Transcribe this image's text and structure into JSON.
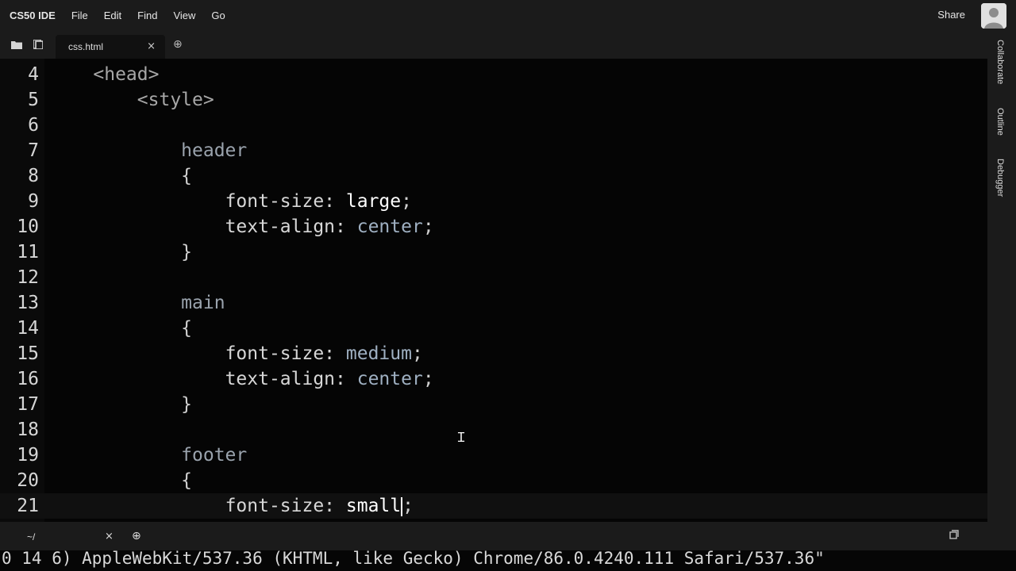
{
  "menubar": {
    "brand": "CS50 IDE",
    "items": [
      "File",
      "Edit",
      "Find",
      "View",
      "Go"
    ],
    "share_label": "Share"
  },
  "tabs": {
    "active_file": "css.html",
    "close_glyph": "×",
    "add_glyph": "⊕"
  },
  "sidebar": {
    "items": [
      "Collaborate",
      "Outline",
      "Debugger"
    ]
  },
  "editor": {
    "lines": [
      {
        "n": "4",
        "tokens": [
          {
            "t": "    ",
            "c": "tok-tag"
          },
          {
            "t": "<head>",
            "c": "tok-tag"
          }
        ]
      },
      {
        "n": "5",
        "tokens": [
          {
            "t": "        ",
            "c": "tok-tag"
          },
          {
            "t": "<style>",
            "c": "tok-tag"
          }
        ]
      },
      {
        "n": "6",
        "tokens": []
      },
      {
        "n": "7",
        "tokens": [
          {
            "t": "            ",
            "c": "tok-sel"
          },
          {
            "t": "header",
            "c": "tok-sel"
          }
        ]
      },
      {
        "n": "8",
        "tokens": [
          {
            "t": "            ",
            "c": "tok-punct"
          },
          {
            "t": "{",
            "c": "tok-punct"
          }
        ]
      },
      {
        "n": "9",
        "tokens": [
          {
            "t": "                ",
            "c": "tok-prop"
          },
          {
            "t": "font-size: ",
            "c": "tok-prop"
          },
          {
            "t": "large",
            "c": "tok-kw"
          },
          {
            "t": ";",
            "c": "tok-punct"
          }
        ]
      },
      {
        "n": "10",
        "tokens": [
          {
            "t": "                ",
            "c": "tok-prop"
          },
          {
            "t": "text-align: ",
            "c": "tok-prop"
          },
          {
            "t": "center",
            "c": "tok-val"
          },
          {
            "t": ";",
            "c": "tok-punct"
          }
        ]
      },
      {
        "n": "11",
        "tokens": [
          {
            "t": "            ",
            "c": "tok-punct"
          },
          {
            "t": "}",
            "c": "tok-punct"
          }
        ]
      },
      {
        "n": "12",
        "tokens": []
      },
      {
        "n": "13",
        "tokens": [
          {
            "t": "            ",
            "c": "tok-sel"
          },
          {
            "t": "main",
            "c": "tok-sel"
          }
        ]
      },
      {
        "n": "14",
        "tokens": [
          {
            "t": "            ",
            "c": "tok-punct"
          },
          {
            "t": "{",
            "c": "tok-punct"
          }
        ]
      },
      {
        "n": "15",
        "tokens": [
          {
            "t": "                ",
            "c": "tok-prop"
          },
          {
            "t": "font-size: ",
            "c": "tok-prop"
          },
          {
            "t": "medium",
            "c": "tok-val"
          },
          {
            "t": ";",
            "c": "tok-punct"
          }
        ]
      },
      {
        "n": "16",
        "tokens": [
          {
            "t": "                ",
            "c": "tok-prop"
          },
          {
            "t": "text-align: ",
            "c": "tok-prop"
          },
          {
            "t": "center",
            "c": "tok-val"
          },
          {
            "t": ";",
            "c": "tok-punct"
          }
        ]
      },
      {
        "n": "17",
        "tokens": [
          {
            "t": "            ",
            "c": "tok-punct"
          },
          {
            "t": "}",
            "c": "tok-punct"
          }
        ]
      },
      {
        "n": "18",
        "tokens": []
      },
      {
        "n": "19",
        "tokens": [
          {
            "t": "            ",
            "c": "tok-sel"
          },
          {
            "t": "footer",
            "c": "tok-sel"
          }
        ]
      },
      {
        "n": "20",
        "tokens": [
          {
            "t": "            ",
            "c": "tok-punct"
          },
          {
            "t": "{",
            "c": "tok-punct"
          }
        ]
      },
      {
        "n": "21",
        "tokens": [
          {
            "t": "                ",
            "c": "tok-prop"
          },
          {
            "t": "font-size: ",
            "c": "tok-prop"
          },
          {
            "t": "small",
            "c": "tok-kw"
          },
          {
            "t": "CARET",
            "c": "caret"
          },
          {
            "t": ";",
            "c": "tok-punct"
          }
        ]
      }
    ],
    "active_line": "21"
  },
  "terminal": {
    "tab_label": "~/",
    "close_glyph": "×",
    "add_glyph": "⊕",
    "output": "0 14 6) AppleWebKit/537.36 (KHTML, like Gecko) Chrome/86.0.4240.111 Safari/537.36\""
  },
  "colors": {
    "background": "#050505",
    "panel": "#1b1b1b",
    "text": "#d6d6d6"
  },
  "icons": [
    "folder-icon",
    "file-tree-icon",
    "gear-icon",
    "close-icon",
    "add-tab-icon",
    "text-cursor-icon",
    "maximize-icon"
  ]
}
